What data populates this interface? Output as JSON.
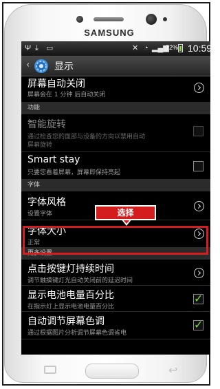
{
  "device": {
    "brand": "SAMSUNG"
  },
  "status_bar": {
    "battery_percent": "72%",
    "time": "10:59"
  },
  "action_bar": {
    "title": "显示"
  },
  "settings": {
    "screen_timeout": {
      "title": "屏幕自动关闭",
      "subtitle": "屏幕会在 1 分钟 后自动关闭"
    },
    "section_function": "功能",
    "smart_rotation": {
      "title": "智能旋转",
      "subtitle_line1": "通过检查您的面部与设备的方向以禁用自动",
      "subtitle_line2": "屏幕旋转",
      "checked": false
    },
    "smart_stay": {
      "title": "Smart stay",
      "subtitle": "只要您看着屏幕，屏幕即保持亮起",
      "checked": false
    },
    "section_font": "字体",
    "font_style": {
      "title": "字体风格",
      "subtitle": "设置字体"
    },
    "font_size": {
      "title": "字体大小",
      "subtitle": "正常"
    },
    "section_more": "更多设置",
    "touch_key_light": {
      "title": "点击按键灯持续时间",
      "subtitle": "调节触摸键灯光自动关闭前的延迟时间"
    },
    "battery_percent": {
      "title": "显示电池电量百分比",
      "subtitle": "在指示灯上显示电池电量百分比",
      "checked": true
    },
    "auto_screen_tone": {
      "title": "自动调节屏幕色调",
      "subtitle": "通过根据图片分析调节屏幕色调省电",
      "checked": true
    }
  },
  "annotation": {
    "label": "选择",
    "color": "#d41d1d"
  },
  "colors": {
    "accent_check": "#7ed84a",
    "highlight": "#d41d1d"
  }
}
